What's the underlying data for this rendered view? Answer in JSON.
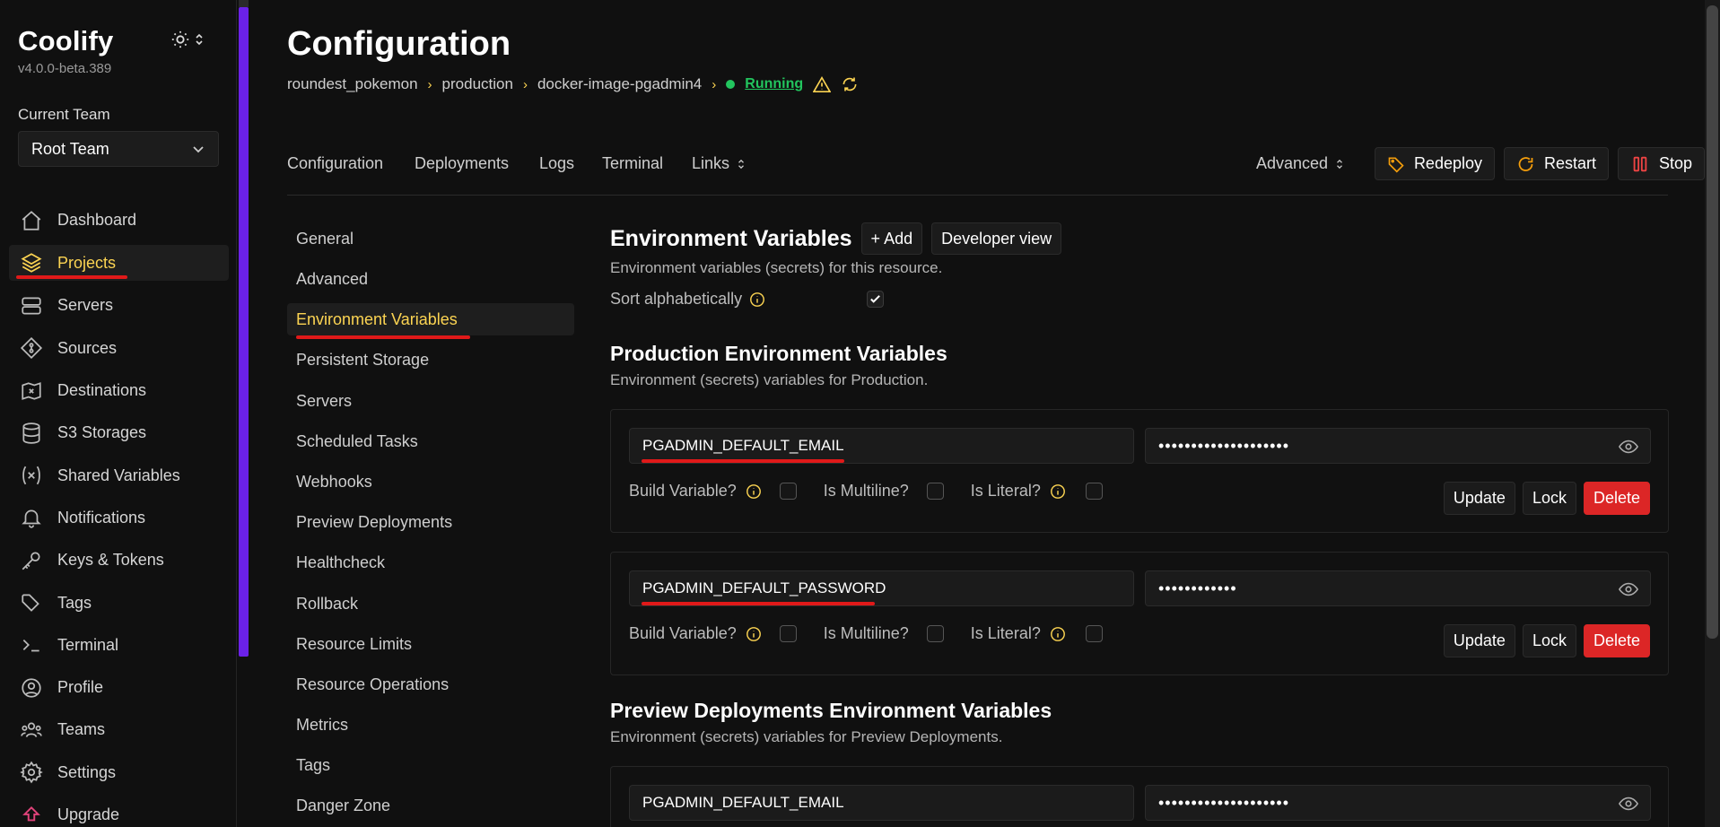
{
  "app": {
    "name": "Coolify",
    "version": "v4.0.0-beta.389"
  },
  "team": {
    "label": "Current Team",
    "selected": "Root Team"
  },
  "sidebar": {
    "items": [
      {
        "label": "Dashboard",
        "icon": "home-icon"
      },
      {
        "label": "Projects",
        "icon": "layers-icon",
        "active": true
      },
      {
        "label": "Servers",
        "icon": "server-icon"
      },
      {
        "label": "Sources",
        "icon": "git-icon"
      },
      {
        "label": "Destinations",
        "icon": "map-x-icon"
      },
      {
        "label": "S3 Storages",
        "icon": "database-icon"
      },
      {
        "label": "Shared Variables",
        "icon": "variable-icon"
      },
      {
        "label": "Notifications",
        "icon": "bell-icon"
      },
      {
        "label": "Keys & Tokens",
        "icon": "key-icon"
      },
      {
        "label": "Tags",
        "icon": "tags-icon"
      },
      {
        "label": "Terminal",
        "icon": "terminal-icon"
      },
      {
        "label": "Profile",
        "icon": "user-icon"
      },
      {
        "label": "Teams",
        "icon": "users-icon"
      },
      {
        "label": "Settings",
        "icon": "gear-icon"
      },
      {
        "label": "Upgrade",
        "icon": "upgrade-icon"
      }
    ]
  },
  "header": {
    "title": "Configuration",
    "breadcrumb": [
      "roundest_pokemon",
      "production",
      "docker-image-pgadmin4"
    ],
    "status": "Running"
  },
  "tabs": {
    "items": [
      "Configuration",
      "Deployments",
      "Logs",
      "Terminal",
      "Links"
    ],
    "advanced": "Advanced",
    "redeploy": "Redeploy",
    "restart": "Restart",
    "stop": "Stop"
  },
  "subnav": {
    "items": [
      "General",
      "Advanced",
      "Environment Variables",
      "Persistent Storage",
      "Servers",
      "Scheduled Tasks",
      "Webhooks",
      "Preview Deployments",
      "Healthcheck",
      "Rollback",
      "Resource Limits",
      "Resource Operations",
      "Metrics",
      "Tags",
      "Danger Zone"
    ]
  },
  "env": {
    "title": "Environment Variables",
    "add_label": "+ Add",
    "developer_view_label": "Developer view",
    "description": "Environment variables (secrets) for this resource.",
    "sort_label": "Sort alphabetically",
    "production": {
      "title": "Production Environment Variables",
      "description": "Environment (secrets) variables for Production.",
      "vars": [
        {
          "key": "PGADMIN_DEFAULT_EMAIL",
          "value": "••••••••••••••••••••"
        },
        {
          "key": "PGADMIN_DEFAULT_PASSWORD",
          "value": "••••••••••••"
        }
      ]
    },
    "preview": {
      "title": "Preview Deployments Environment Variables",
      "description": "Environment (secrets) variables for Preview Deployments.",
      "vars": [
        {
          "key": "PGADMIN_DEFAULT_EMAIL",
          "value": "••••••••••••••••••••"
        }
      ]
    },
    "labels": {
      "build": "Build Variable?",
      "multiline": "Is Multiline?",
      "literal": "Is Literal?",
      "update": "Update",
      "lock": "Lock",
      "delete": "Delete"
    }
  },
  "colors": {
    "accent": "#fcd452",
    "running": "#22c55e",
    "danger": "#dc2626",
    "annotation": "#e01919",
    "purple": "#6b21e8"
  }
}
